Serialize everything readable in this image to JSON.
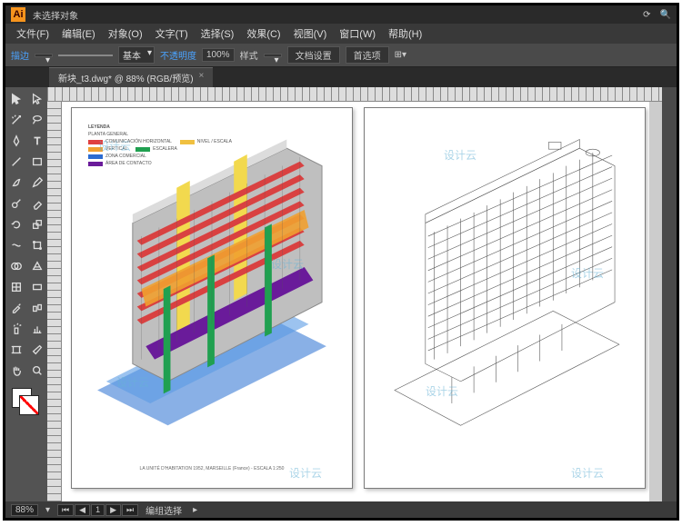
{
  "app": {
    "logo": "Ai",
    "no_selection": "未选择对象"
  },
  "menu": [
    "文件(F)",
    "编辑(E)",
    "对象(O)",
    "文字(T)",
    "选择(S)",
    "效果(C)",
    "视图(V)",
    "窗口(W)",
    "帮助(H)"
  ],
  "control": {
    "fill_label": "",
    "stroke_label": "描边",
    "stroke_pt": "",
    "stroke_style_label": "基本",
    "opacity_label": "不透明度",
    "opacity_value": "100%",
    "style_label": "样式",
    "doc_setup": "文档设置",
    "prefs": "首选项"
  },
  "tab": {
    "title": "新块_t3.dwg* @ 88% (RGB/预览)",
    "close": "×"
  },
  "tools": [
    "selection",
    "direct-select",
    "magic-wand",
    "lasso",
    "pen",
    "type",
    "line",
    "rectangle",
    "brush",
    "pencil",
    "blob",
    "eraser",
    "rotate",
    "scale",
    "width",
    "free-transform",
    "shape-builder",
    "perspective",
    "mesh",
    "gradient",
    "eyedropper",
    "blend",
    "symbol-spray",
    "graph",
    "artboard",
    "slice",
    "hand",
    "zoom"
  ],
  "legend": {
    "title": "LEYENDA",
    "rows": [
      {
        "label": "PLANTA GENERAL",
        "color": "#d9d9d9"
      },
      {
        "label": "COMUNICACIÓN HORIZONTAL",
        "color": "#e04040",
        "label2": "NIVEL / ESCALA"
      },
      {
        "label": "VERTICAL",
        "color": "#f0a030",
        "label2": "ESCALERA"
      },
      {
        "label": "ZONA COMERCIAL",
        "color": "#2b6bd1"
      },
      {
        "label": "ÁREA DE CONTACTO",
        "color": "#20a050"
      }
    ]
  },
  "caption": "LA UNITÉ D'HABITATION 1952, MARSEILLE (France) - ESCALA 1:250",
  "watermark": "设计云",
  "status": {
    "zoom": "88%",
    "artboard_current": "1",
    "navigate_label": "编组选择"
  }
}
